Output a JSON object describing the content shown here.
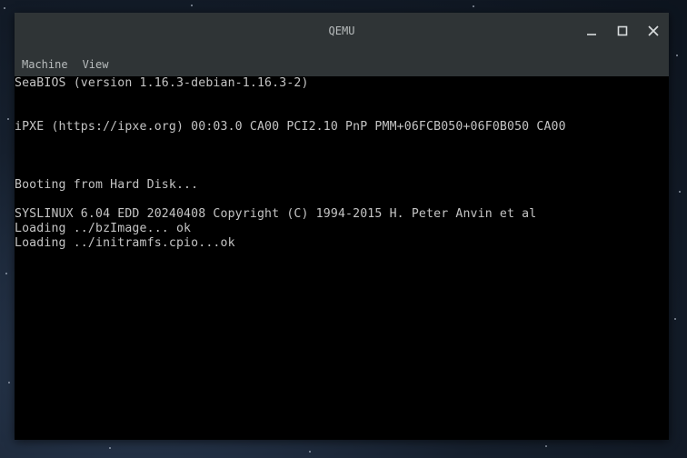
{
  "window": {
    "title": "QEMU"
  },
  "menu": {
    "items": [
      "Machine",
      "View"
    ]
  },
  "console": {
    "lines": [
      "SeaBIOS (version 1.16.3-debian-1.16.3-2)",
      "iPXE (https://ipxe.org) 00:03.0 CA00 PCI2.10 PnP PMM+06FCB050+06F0B050 CA00",
      "Booting from Hard Disk...",
      "SYSLINUX 6.04 EDD 20240408 Copyright (C) 1994-2015 H. Peter Anvin et al",
      "Loading ../bzImage... ok",
      "Loading ../initramfs.cpio...ok"
    ]
  },
  "icons": {
    "minimize": "minimize-icon",
    "maximize": "maximize-icon",
    "close": "close-icon"
  },
  "colors": {
    "titlebar": "#2f3436",
    "console_text": "#c4c4c4",
    "console_bg": "#000000"
  }
}
